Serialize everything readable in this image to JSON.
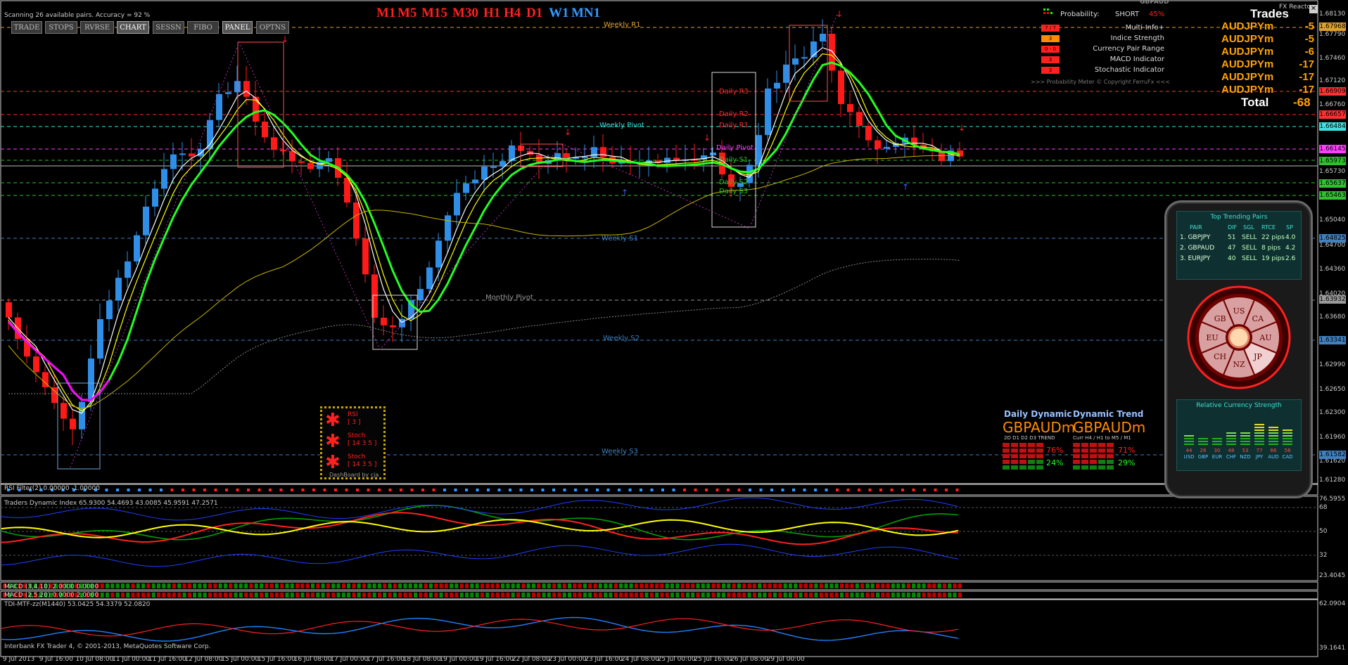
{
  "status": {
    "scan_text": "Scanning 26 available pairs.  Accuracy = 92 %",
    "footer_text": "Interbank FX Trader 4, © 2001-2013, MetaQuotes Software Corp."
  },
  "toolbar": [
    "TRADE",
    "STOPS",
    "RVRSE",
    "CHART",
    "SESSN",
    "FIBO",
    "PANEL",
    "OPTNS"
  ],
  "timeframes": [
    {
      "label": "M1",
      "color": "#ff2020"
    },
    {
      "label": "M5",
      "color": "#ff2020"
    },
    {
      "label": "M15",
      "color": "#ff2020"
    },
    {
      "label": "M30",
      "color": "#ff2020"
    },
    {
      "label": "H1",
      "color": "#ff2020"
    },
    {
      "label": "H4",
      "color": "#ff2020"
    },
    {
      "label": "D1",
      "color": "#ff2020"
    },
    {
      "label": "W1",
      "color": "#3399ff"
    },
    {
      "label": "MN1",
      "color": "#3399ff"
    }
  ],
  "probability": {
    "pair": "GBPAUD",
    "title": "Probability:",
    "direction": "SHORT",
    "percent": "45%",
    "rows": [
      {
        "value": "7 / 7",
        "label": "Multi-Info+",
        "color": "#ff2020"
      },
      {
        "value": "3",
        "label": "Indice Strength",
        "color": "#ff8c00"
      },
      {
        "value": "0 - 0",
        "label": "Currency Pair Range",
        "color": "#ff2020"
      },
      {
        "value": "3",
        "label": "MACD Indicator",
        "color": "#ff2020"
      },
      {
        "value": "3",
        "label": "Stochastic Indicator",
        "color": "#ff2020"
      }
    ],
    "footer": ">>> Probability Meter © Copyright FerruFx <<<",
    "reactor": "FX Reactor"
  },
  "trades": {
    "title": "Trades",
    "rows": [
      {
        "pair": "AUDJPYm",
        "value": "-5"
      },
      {
        "pair": "AUDJPYm",
        "value": "-5"
      },
      {
        "pair": "AUDJPYm",
        "value": "-6"
      },
      {
        "pair": "AUDJPYm",
        "value": "-17"
      },
      {
        "pair": "AUDJPYm",
        "value": "-17"
      },
      {
        "pair": "AUDJPYm",
        "value": "-17"
      }
    ],
    "total_label": "Total",
    "total_value": "-68"
  },
  "trending": {
    "title": "Top Trending Pairs",
    "headers": [
      "PAIR",
      "DIF",
      "SGL",
      "RTCE",
      "SP"
    ],
    "rows": [
      [
        "1. GBPJPY",
        "51",
        "SELL",
        "22 pips",
        "4.0"
      ],
      [
        "2. GBPAUD",
        "47",
        "SELL",
        "8 pips",
        "4.2"
      ],
      [
        "3. EURJPY",
        "40",
        "SELL",
        "19 pips",
        "2.6"
      ]
    ],
    "wheel": [
      "US",
      "CA",
      "AU",
      "JP",
      "NZ",
      "CH",
      "EU",
      "GB"
    ],
    "rcs_title": "Relative Currency Strength",
    "rcs_values": [
      "44",
      "26",
      "30",
      "48",
      "53",
      "77",
      "66",
      "58"
    ],
    "rcs_labels": [
      "USD",
      "GBP",
      "EUR",
      "CHF",
      "NZD",
      "JPY",
      "AUD",
      "CAD"
    ]
  },
  "dashboard": {
    "daily_title": "Daily Dynamic",
    "trend_title": "Dynamic Trend",
    "pair": "GBPAUDm",
    "daily_cols": "2D  D1  D2  D3 TREND",
    "trend_cols": "Curr H4 / H1  to  M5 / M1",
    "daily_pct1": "76%",
    "daily_pct2": "24%",
    "trend_pct1": "71%",
    "trend_pct2": "29%"
  },
  "signal_box": {
    "items": [
      {
        "name": "RSI",
        "param": "[ 3 ]"
      },
      {
        "name": "Stoch",
        "param": "[ 14 3 5 ]"
      },
      {
        "name": "Stoch",
        "param": "[ 14 3 5 ]"
      }
    ],
    "footer": "DashBoard by cja"
  },
  "pivots": [
    {
      "label": "Weekly R1",
      "color": "#e0a030"
    },
    {
      "label": "Daily R3",
      "color": "#ff3030"
    },
    {
      "label": "Daily R2",
      "color": "#ff3030"
    },
    {
      "label": "Daily R1",
      "color": "#ff3030"
    },
    {
      "label": "Weekly Pivot",
      "color": "#40e0e0"
    },
    {
      "label": "Daily Pivot",
      "color": "#ff40ff"
    },
    {
      "label": "Daily S1",
      "color": "#30c030"
    },
    {
      "label": "Daily S2",
      "color": "#30c030"
    },
    {
      "label": "Daily S3",
      "color": "#30c030"
    },
    {
      "label": "Weekly S1",
      "color": "#4080c0"
    },
    {
      "label": "Monthly Pivot",
      "color": "#999999"
    },
    {
      "label": "Weekly S2",
      "color": "#4080c0"
    },
    {
      "label": "Weekly S3",
      "color": "#4080c0"
    }
  ],
  "price_ticks": [
    "1.68130",
    "1.67790",
    "1.67460",
    "1.67120",
    "1.66760",
    "1.66410",
    "1.65730",
    "1.65390",
    "1.65040",
    "1.64700",
    "1.64360",
    "1.64020",
    "1.63680",
    "1.63340",
    "1.62990",
    "1.62650",
    "1.62300",
    "1.61960",
    "1.61620",
    "1.61280"
  ],
  "price_tags": [
    {
      "value": "1.67968",
      "color": "#e0a030"
    },
    {
      "value": "1.66909",
      "color": "#ff3030"
    },
    {
      "value": "1.66657",
      "color": "#ff3030"
    },
    {
      "value": "1.66484",
      "color": "#40e0e0"
    },
    {
      "value": "1.66145",
      "color": "#ff40ff"
    },
    {
      "value": "1.65973",
      "color": "#30c030"
    },
    {
      "value": "1.65637",
      "color": "#30c030"
    },
    {
      "value": "1.65463",
      "color": "#30c030"
    },
    {
      "value": "1.64825",
      "color": "#4080c0"
    },
    {
      "value": "1.63932",
      "color": "#999999"
    },
    {
      "value": "1.63341",
      "color": "#4080c0"
    },
    {
      "value": "1.61582",
      "color": "#4080c0"
    }
  ],
  "date_labels": [
    "9 Jul 2013",
    "9 Jul 16:00",
    "10 Jul 08:00",
    "11 Jul 00:00",
    "11 Jul 16:00",
    "12 Jul 08:00",
    "15 Jul 00:00",
    "15 Jul 16:00",
    "16 Jul 08:00",
    "17 Jul 00:00",
    "17 Jul 16:00",
    "18 Jul 08:00",
    "19 Jul 00:00",
    "19 Jul 16:00",
    "22 Jul 08:00",
    "23 Jul 00:00",
    "23 Jul 16:00",
    "24 Jul 08:00",
    "25 Jul 00:00",
    "25 Jul 16:00",
    "26 Jul 08:00",
    "29 Jul 00:00"
  ],
  "subwindows": {
    "rsi_filter": "RSI Filter(2) 0.00000 -1.00000",
    "tdi": "Traders Dynamic Index 65.9300 54.4693 43.0085 45.9591 47.2571",
    "tdi_levels": [
      "76.5955",
      "68",
      "50",
      "32",
      "23.4045"
    ],
    "macd1": "MACD (3,4,10) 2.0000 0.0000",
    "macd2": "MACD (2,5,20) 0.0000 2.0000",
    "tdi_mtf": "TDI-MTF-zz(M1440) 53.0425 54.3379 52.0820",
    "tdi_mtf_levels": [
      "62.0904",
      "39.1641"
    ]
  }
}
